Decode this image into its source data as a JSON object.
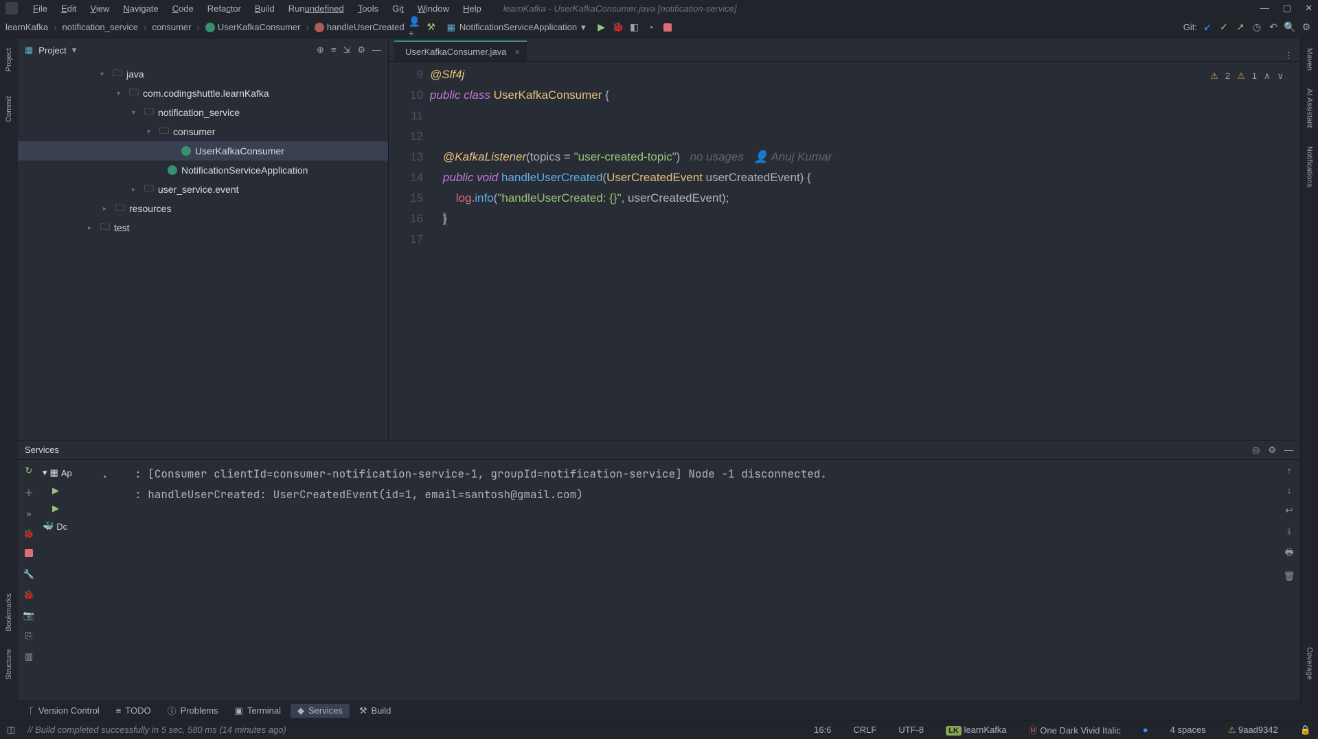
{
  "menu": {
    "items": [
      "File",
      "Edit",
      "View",
      "Navigate",
      "Code",
      "Refactor",
      "Build",
      "Run",
      "Tools",
      "Git",
      "Window",
      "Help"
    ],
    "underline": [
      0,
      0,
      0,
      0,
      0,
      4,
      0,
      3,
      0,
      2,
      0,
      0
    ]
  },
  "window_title": "learnKafka - UserKafkaConsumer.java [notification-service]",
  "breadcrumbs": [
    "learnKafka",
    "notification_service",
    "consumer",
    "UserKafkaConsumer",
    "handleUserCreated"
  ],
  "run_config": "NotificationServiceApplication",
  "git_label": "Git:",
  "project": {
    "title": "Project",
    "tree": [
      {
        "indent": 120,
        "arrow": "▾",
        "icon": "📁",
        "label": "java"
      },
      {
        "indent": 144,
        "arrow": "▾",
        "icon": "📁",
        "label": "com.codingshuttle.learnKafka"
      },
      {
        "indent": 166,
        "arrow": "▾",
        "icon": "📁",
        "label": "notification_service"
      },
      {
        "indent": 188,
        "arrow": "▾",
        "icon": "📁",
        "label": "consumer"
      },
      {
        "indent": 220,
        "arrow": "",
        "icon": "c",
        "label": "UserKafkaConsumer",
        "selected": true
      },
      {
        "indent": 200,
        "arrow": "",
        "icon": "c2",
        "label": "NotificationServiceApplication"
      },
      {
        "indent": 166,
        "arrow": "▸",
        "icon": "📁",
        "label": "user_service.event"
      },
      {
        "indent": 124,
        "arrow": "▸",
        "icon": "📁",
        "label": "resources"
      },
      {
        "indent": 102,
        "arrow": "▸",
        "icon": "📁",
        "label": "test"
      }
    ]
  },
  "tab": {
    "name": "UserKafkaConsumer.java"
  },
  "inspections": {
    "warn1": "2",
    "warn2": "1"
  },
  "code_hint": {
    "usages": "no usages",
    "author": "Anuj Kumar"
  },
  "lines": {
    "l9": "@Slf4j",
    "l10_public": "public",
    "l10_class": "class",
    "l10_name": "UserKafkaConsumer",
    "l10_brace": " {",
    "l13_ann": "@KafkaListener",
    "l13_params": "(topics = ",
    "l13_str": "\"user-created-topic\"",
    "l13_close": ")",
    "l14_public": "public",
    "l14_void": "void",
    "l14_method": "handleUserCreated",
    "l14_paren": "(",
    "l14_type": "UserCreatedEvent",
    "l14_arg": " userCreatedEvent)",
    "l14_brace": " {",
    "l15_obj": "log",
    "l15_dot": ".",
    "l15_m": "info",
    "l15_open": "(",
    "l15_str": "\"handleUserCreated: {}\"",
    "l15_rest": ", userCreatedEvent);",
    "l16": "}"
  },
  "gutter_lines": [
    "9",
    "10",
    "11",
    "12",
    "13",
    "14",
    "15",
    "16",
    "17"
  ],
  "services": {
    "title": "Services",
    "tree": [
      "Ap",
      "Dc"
    ],
    "console": [
      ".    : [Consumer clientId=consumer-notification-service-1, groupId=notification-service] Node -1 disconnected.",
      "     : handleUserCreated: UserCreatedEvent(id=1, email=santosh@gmail.com)"
    ]
  },
  "bottom_tools": [
    "Version Control",
    "TODO",
    "Problems",
    "Terminal",
    "Services",
    "Build"
  ],
  "status": {
    "msg": "// Build completed successfully in 5 sec, 580 ms (14 minutes ago)",
    "caret": "16:6",
    "eol": "CRLF",
    "enc": "UTF-8",
    "project_badge": "LK",
    "project": "learnKafka",
    "theme": "One Dark Vivid Italic",
    "indent": "4 spaces",
    "branch": "9aad9342"
  },
  "left_tabs": [
    "Project",
    "Commit",
    "Bookmarks",
    "Structure"
  ],
  "right_tabs": [
    "Maven",
    "AI Assistant",
    "Notifications",
    "Coverage"
  ]
}
